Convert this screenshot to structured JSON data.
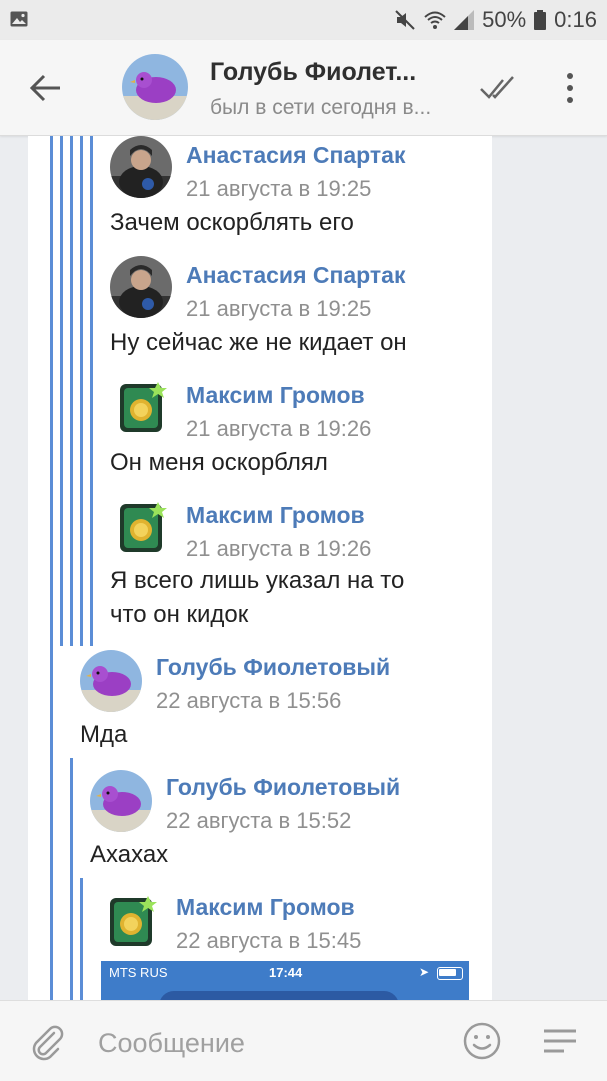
{
  "status_bar": {
    "battery": "50%",
    "time": "0:16"
  },
  "header": {
    "title": "Голубь Фиолет...",
    "subtitle": "был в сети сегодня в..."
  },
  "messages": [
    {
      "author": "Анастасия Спартак",
      "date": "21 августа в 19:25",
      "lines": [
        "Зачем оскорблять его"
      ]
    },
    {
      "author": "Анастасия Спартак",
      "date": "21 августа в 19:25",
      "lines": [
        "Ну сейчас же не кидает он"
      ]
    },
    {
      "author": "Максим Громов",
      "date": "21 августа в 19:26",
      "lines": [
        "Он меня оскорблял"
      ]
    },
    {
      "author": "Максим Громов",
      "date": "21 августа в 19:26",
      "lines": [
        "Я всего лишь указал на то",
        "что он кидок"
      ]
    },
    {
      "author": "Голубь Фиолетовый",
      "date": "22 августа в 15:56",
      "lines": [
        "Мда"
      ]
    },
    {
      "author": "Голубь Фиолетовый",
      "date": "22 августа в 15:52",
      "lines": [
        "Ахахах"
      ]
    },
    {
      "author": "Максим Громов",
      "date": "22 августа в 15:45",
      "lines": []
    }
  ],
  "attachment_preview": {
    "carrier": "MTS RUS",
    "time": "17:44"
  },
  "composer": {
    "placeholder": "Сообщение"
  },
  "colors": {
    "accent": "#4d7bb8",
    "thread_line": "#5b8dd6"
  }
}
